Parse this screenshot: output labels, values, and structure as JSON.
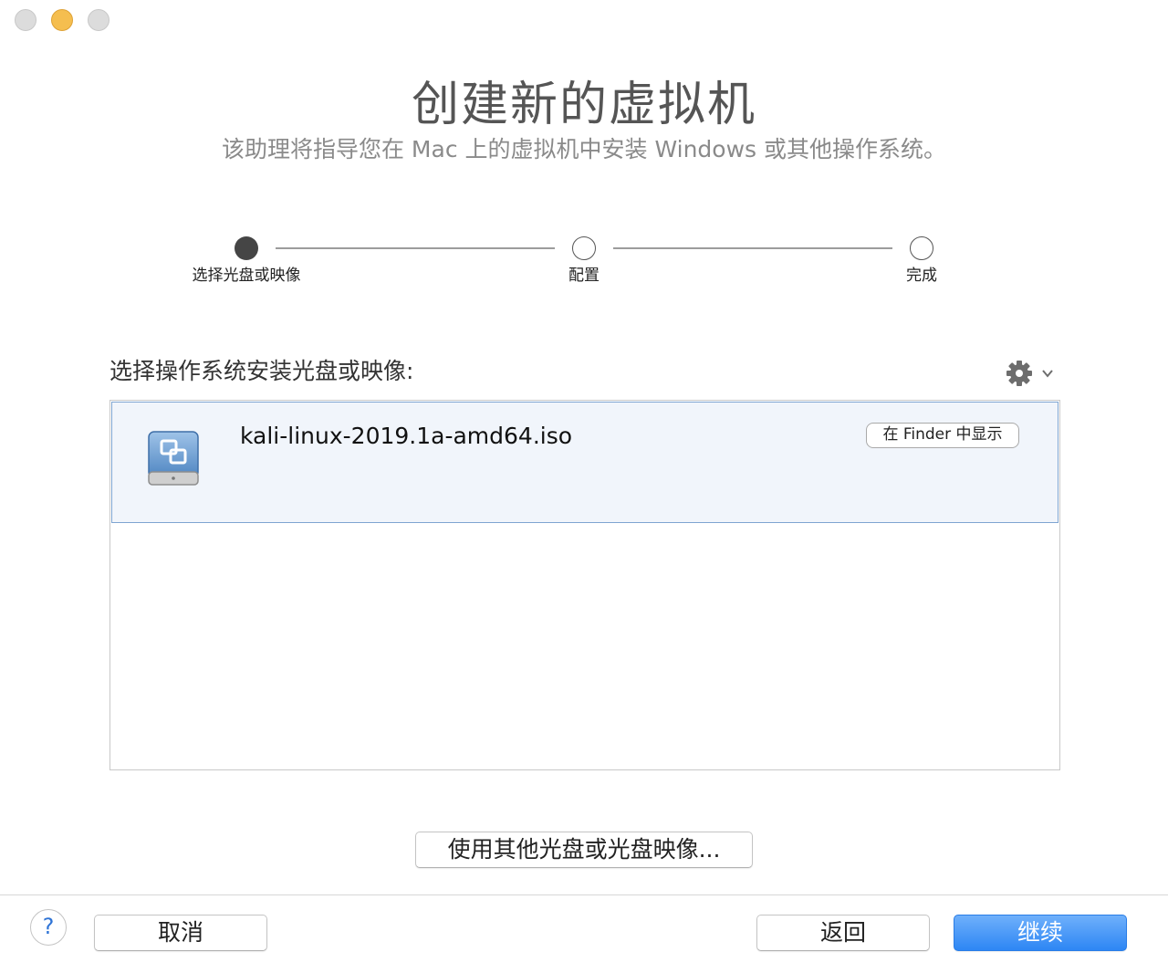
{
  "window": {
    "title": "创建新的虚拟机",
    "subtitle": "该助理将指导您在 Mac 上的虚拟机中安装 Windows 或其他操作系统。"
  },
  "steps": [
    {
      "label": "选择光盘或映像",
      "state": "active"
    },
    {
      "label": "配置",
      "state": "pending"
    },
    {
      "label": "完成",
      "state": "pending"
    }
  ],
  "source": {
    "label": "选择操作系统安装光盘或映像:",
    "gear_icon": "gear-icon",
    "items": [
      {
        "name": "kali-linux-2019.1a-amd64.iso",
        "icon": "disk-image-icon",
        "action_label": "在 Finder 中显示",
        "selected": true
      }
    ],
    "other_button_label": "使用其他光盘或光盘映像..."
  },
  "footer": {
    "help_label": "?",
    "cancel_label": "取消",
    "back_label": "返回",
    "continue_label": "继续"
  },
  "colors": {
    "accent": "#2d86f4",
    "selection_bg": "#f1f5fb",
    "selection_border": "#7ea5d1",
    "traffic_min": "#f5be4f"
  }
}
